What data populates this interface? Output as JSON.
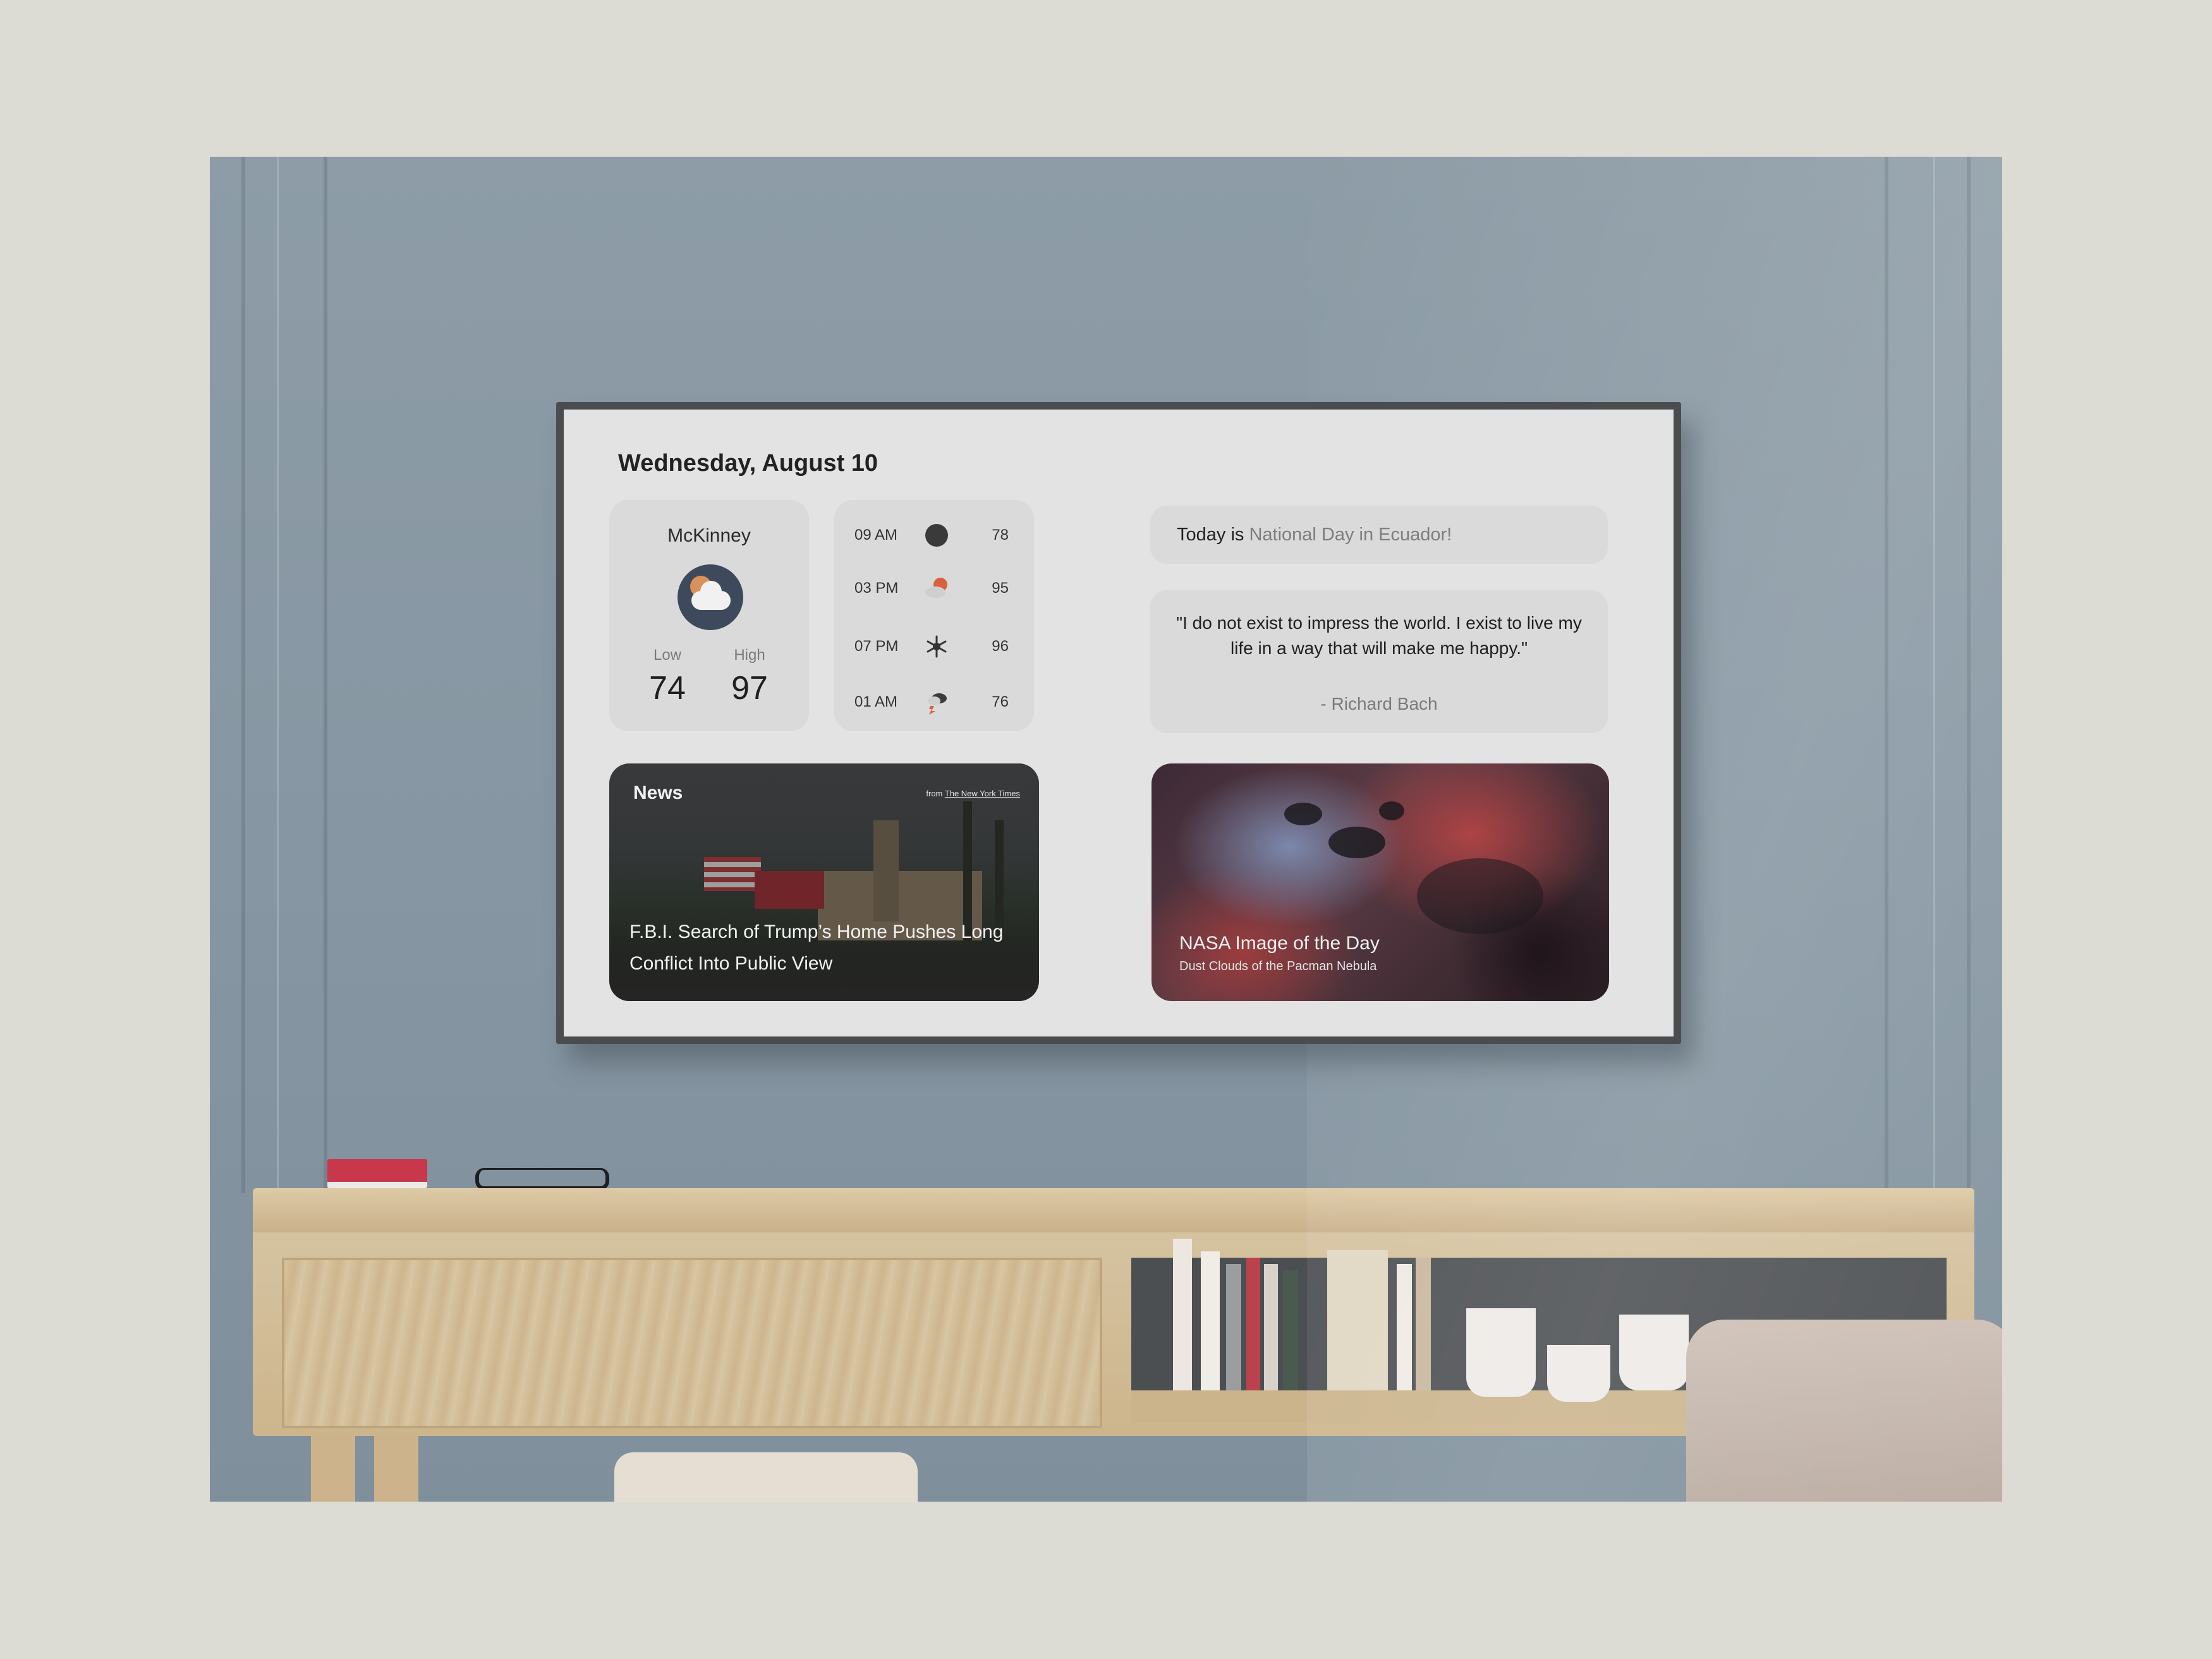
{
  "dashboard": {
    "date": "Wednesday, August 10"
  },
  "weather": {
    "city": "McKinney",
    "icon": "partly-cloudy-icon",
    "low_label": "Low",
    "low_value": "74",
    "high_label": "High",
    "high_value": "97"
  },
  "hourly": [
    {
      "time": "09 AM",
      "icon": "moon-icon",
      "temp": "78"
    },
    {
      "time": "03 PM",
      "icon": "partly-cloudy-sun-icon",
      "temp": "95"
    },
    {
      "time": "07 PM",
      "icon": "snowflake-icon",
      "temp": "96"
    },
    {
      "time": "01 AM",
      "icon": "thunderstorm-icon",
      "temp": "76"
    }
  ],
  "today_fact": {
    "prefix": "Today is",
    "value": "National Day in Ecuador!"
  },
  "quote": {
    "text": "\"I do not exist to impress the world. I exist to live my life in a way that will make me happy.\"",
    "author": "- Richard Bach"
  },
  "news": {
    "label": "News",
    "source_prefix": "from",
    "source": "The New York Times",
    "headline": "F.B.I. Search of Trump’s Home Pushes Long Conflict Into Public View"
  },
  "nasa": {
    "title": "NASA Image of the Day",
    "subtitle": "Dust Clouds of the Pacman Nebula"
  },
  "colors": {
    "screen_bg": "#e3e3e3",
    "card_bg": "#dadada",
    "weather_icon_bg": "#3e4a5c",
    "accent_orange": "#d8915a"
  }
}
